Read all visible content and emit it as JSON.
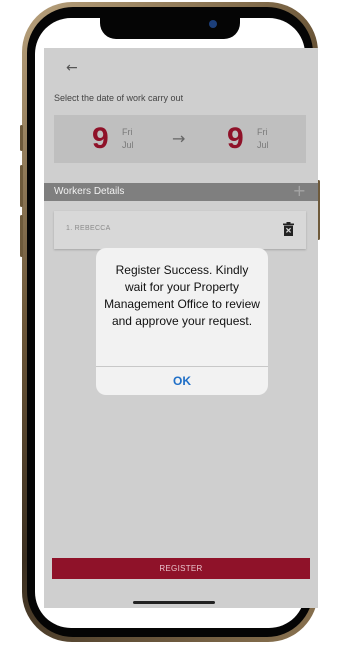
{
  "header": {
    "back_icon": "←"
  },
  "date_section": {
    "title": "Select the date of work carry out",
    "start": {
      "day": "9",
      "dow": "Fri",
      "month": "Jul"
    },
    "arrow": "→",
    "end": {
      "day": "9",
      "dow": "Fri",
      "month": "Jul"
    }
  },
  "workers": {
    "title": "Workers Details",
    "add_icon": "+",
    "items": [
      {
        "label": "1. REBECCA"
      }
    ]
  },
  "alert": {
    "message": "Register Success. Kindly wait for your Property Management Office to review and approve your request.",
    "ok_label": "OK"
  },
  "register_label": "REGISTER",
  "colors": {
    "brand": "#8f1229",
    "overlay_bg": "#cfcfcf",
    "alert_button": "#1f6fc7"
  },
  "icons": [
    "back-arrow-icon",
    "right-arrow-icon",
    "plus-icon",
    "trash-icon"
  ]
}
